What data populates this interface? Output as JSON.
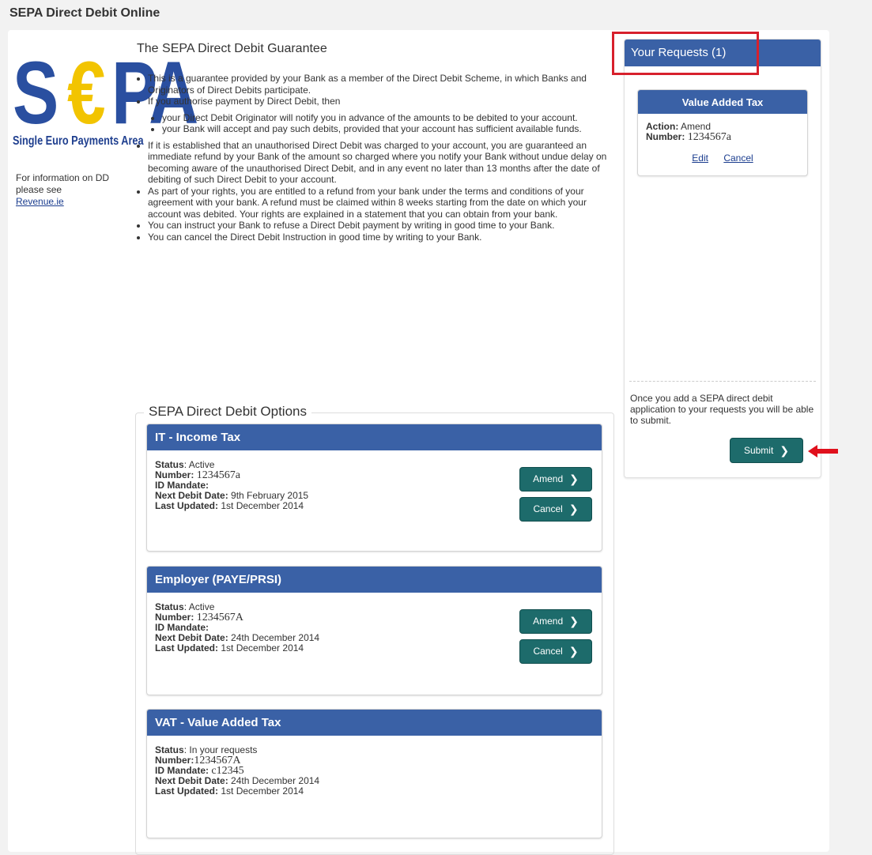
{
  "app": {
    "title": "SEPA Direct Debit Online"
  },
  "logo": {
    "letters_s": "S",
    "letters_euro": "€",
    "letters_pa": "PA",
    "subtitle": "Single Euro Payments Area"
  },
  "info": {
    "text": "For information on DD please see",
    "link": "Revenue.ie"
  },
  "guarantee": {
    "title": "The SEPA Direct Debit Guarantee",
    "items": [
      "This is a guarantee provided by your Bank as a member of the Direct Debit Scheme, in which Banks and Originators of Direct Debits participate.",
      "If you authorise payment by Direct Debit, then"
    ],
    "sub_items": [
      "your Direct Debit Originator will notify you in advance of the amounts to be debited to your account.",
      "your Bank will accept and pay such debits, provided that your account has sufficient available funds."
    ],
    "items_after": [
      "If it is established that an unauthorised Direct Debit was charged to your account, you are guaranteed an immediate refund by your Bank of the amount so charged where you notify your Bank without undue delay on becoming aware of the unauthorised Direct Debit, and in any event no later than 13 months after the date of debiting of such Direct Debit to your account.",
      "As part of your rights, you are entitled to a refund from your bank under the terms and conditions of your agreement with your bank. A refund must be claimed within 8 weeks starting from the date on which your account was debited. Your rights are explained in a statement that you can obtain from your bank.",
      "You can instruct your Bank to refuse a Direct Debit payment by writing in good time to your Bank.",
      "You can cancel the Direct Debit Instruction in good time by writing to your Bank."
    ]
  },
  "options": {
    "legend": "SEPA Direct Debit Options",
    "labels": {
      "status": "Status",
      "number": "Number:",
      "id_mandate": "ID Mandate:",
      "next_debit": "Next Debit Date:",
      "last_updated": "Last Updated:"
    },
    "cards": [
      {
        "title": "IT - Income Tax",
        "status": "Active",
        "number": "1234567a",
        "id_mandate": "",
        "next_debit": "9th February 2015",
        "last_updated": "1st December 2014",
        "amend": "Amend",
        "cancel": "Cancel"
      },
      {
        "title": "Employer (PAYE/PRSI)",
        "status": "Active",
        "number": "1234567A",
        "id_mandate": "",
        "next_debit": "24th December 2014",
        "last_updated": "1st December 2014",
        "amend": "Amend",
        "cancel": "Cancel"
      },
      {
        "title": "VAT - Value Added Tax",
        "status": "In your requests",
        "number": "1234567A",
        "id_mandate": "c12345",
        "next_debit": "24th December 2014",
        "last_updated": "1st December 2014"
      }
    ]
  },
  "requests": {
    "header": "Your Requests (1)",
    "card": {
      "title": "Value Added Tax",
      "action_label": "Action:",
      "action": "Amend",
      "number_label": "Number:",
      "number": "1234567a",
      "edit": "Edit",
      "cancel": "Cancel"
    },
    "note": "Once you add a SEPA direct debit application to your requests you will be able to submit.",
    "submit": "Submit"
  },
  "colors": {
    "header_blue": "#3a61a6",
    "button_teal": "#1d6b6b",
    "highlight_red": "#d7202c"
  },
  "icons": {
    "chevron": "chevron-right-icon",
    "arrow": "red-arrow-left-icon"
  }
}
